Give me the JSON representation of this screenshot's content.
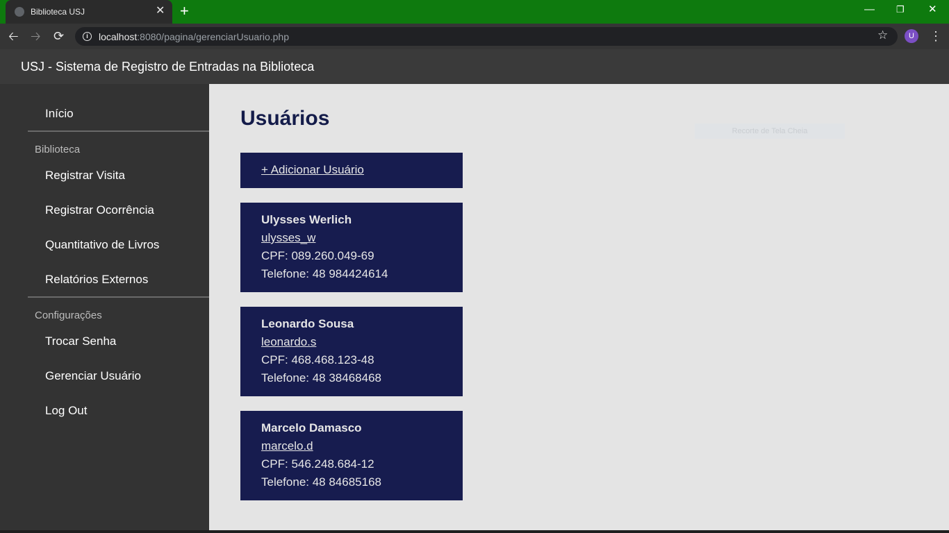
{
  "browser": {
    "tab_title": "Biblioteca USJ",
    "tab_close": "✕",
    "new_tab": "+",
    "url_host": "localhost",
    "url_path": ":8080/pagina/gerenciarUsuario.php",
    "avatar_letter": "U"
  },
  "header": {
    "title": "USJ - Sistema de Registro de Entradas na Biblioteca"
  },
  "sidebar": {
    "home": "Início",
    "sections": [
      {
        "title": "Biblioteca",
        "items": [
          "Registrar Visita",
          "Registrar Ocorrência",
          "Quantitativo de Livros",
          "Relatórios Externos"
        ]
      },
      {
        "title": "Configurações",
        "items": [
          "Trocar Senha",
          "Gerenciar Usuário",
          "Log Out"
        ]
      }
    ]
  },
  "main": {
    "title": "Usuários",
    "add_user_label": "+ Adicionar Usuário",
    "watermark": "Recorte de Tela Cheia",
    "users": [
      {
        "name": "Ulysses Werlich",
        "login": "ulysses_w",
        "cpf": "CPF: 089.260.049-69",
        "phone": "Telefone: 48 984424614"
      },
      {
        "name": "Leonardo Sousa",
        "login": "leonardo.s",
        "cpf": "CPF: 468.468.123-48",
        "phone": "Telefone: 48 38468468"
      },
      {
        "name": "Marcelo Damasco",
        "login": "marcelo.d",
        "cpf": "CPF: 546.248.684-12",
        "phone": "Telefone: 48 84685168"
      }
    ]
  },
  "colors": {
    "accent": "#171c4f",
    "title": "#141c4a",
    "sidebar": "#333333",
    "tabstrip": "#0e7a0e"
  }
}
